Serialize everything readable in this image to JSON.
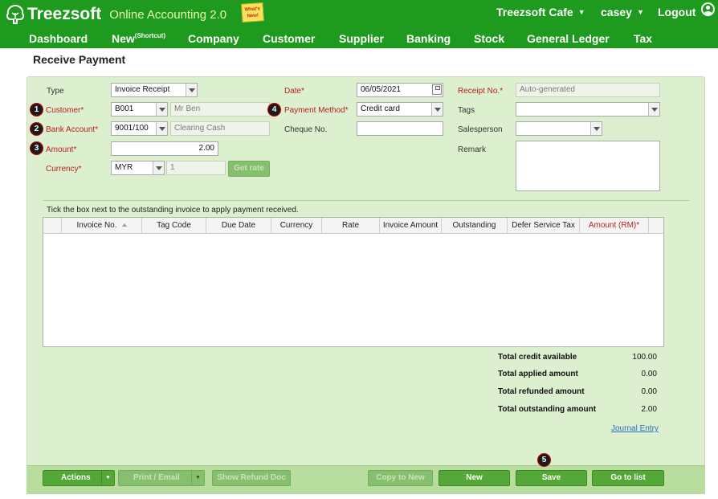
{
  "header": {
    "brand": "Treezsoft",
    "product": "Online Accounting 2.0",
    "whats_new": "What's New!",
    "company_menu": "Treezsoft Cafe",
    "user_menu": "casey",
    "logout": "Logout"
  },
  "nav": {
    "items": [
      "Dashboard",
      "New",
      "Company",
      "Customer",
      "Supplier",
      "Banking",
      "Stock",
      "General Ledger",
      "Tax"
    ],
    "new_sup": "(Shortcut)"
  },
  "page": {
    "title": "Receive Payment"
  },
  "form": {
    "type_label": "Type",
    "type_value": "Invoice Receipt",
    "customer_label": "Customer*",
    "customer_code": "B001",
    "customer_name": "Mr Ben",
    "bank_label": "Bank Account*",
    "bank_code": "9001/100",
    "bank_name": "Clearing Cash",
    "amount_label": "Amount*",
    "amount_value": "2.00",
    "currency_label": "Currency*",
    "currency_value": "MYR",
    "rate_value": "1",
    "get_rate": "Get rate",
    "date_label": "Date*",
    "date_value": "06/05/2021",
    "payment_method_label": "Payment Method*",
    "payment_method_value": "Credit card",
    "cheque_label": "Cheque No.",
    "cheque_value": "",
    "receipt_label": "Receipt No.*",
    "receipt_value": "Auto-generated",
    "tags_label": "Tags",
    "tags_value": "",
    "salesperson_label": "Salesperson",
    "salesperson_value": "",
    "remark_label": "Remark"
  },
  "badges": [
    "1",
    "2",
    "3",
    "4",
    "5"
  ],
  "grid": {
    "hint": "Tick the box next to the outstanding invoice to apply payment received.",
    "columns": [
      "Invoice No.",
      "Tag Code",
      "Due Date",
      "Currency",
      "Rate",
      "Invoice Amount",
      "Outstanding",
      "Defer Service Tax",
      "Amount (RM)*"
    ]
  },
  "totals": [
    {
      "label": "Total credit available",
      "value": "100.00"
    },
    {
      "label": "Total applied amount",
      "value": "0.00"
    },
    {
      "label": "Total refunded amount",
      "value": "0.00"
    },
    {
      "label": "Total outstanding amount",
      "value": "2.00"
    }
  ],
  "journal_link": "Journal Entry",
  "footer": {
    "actions": "Actions",
    "print_email": "Print / Email",
    "show_refund": "Show Refund Doc",
    "copy_new": "Copy to New",
    "new": "New",
    "save": "Save",
    "go_list": "Go to list"
  },
  "colors": {
    "topbar": "#1e9a1e",
    "panel": "#dcefcf",
    "button": "#54a838",
    "required": "#b22222"
  }
}
